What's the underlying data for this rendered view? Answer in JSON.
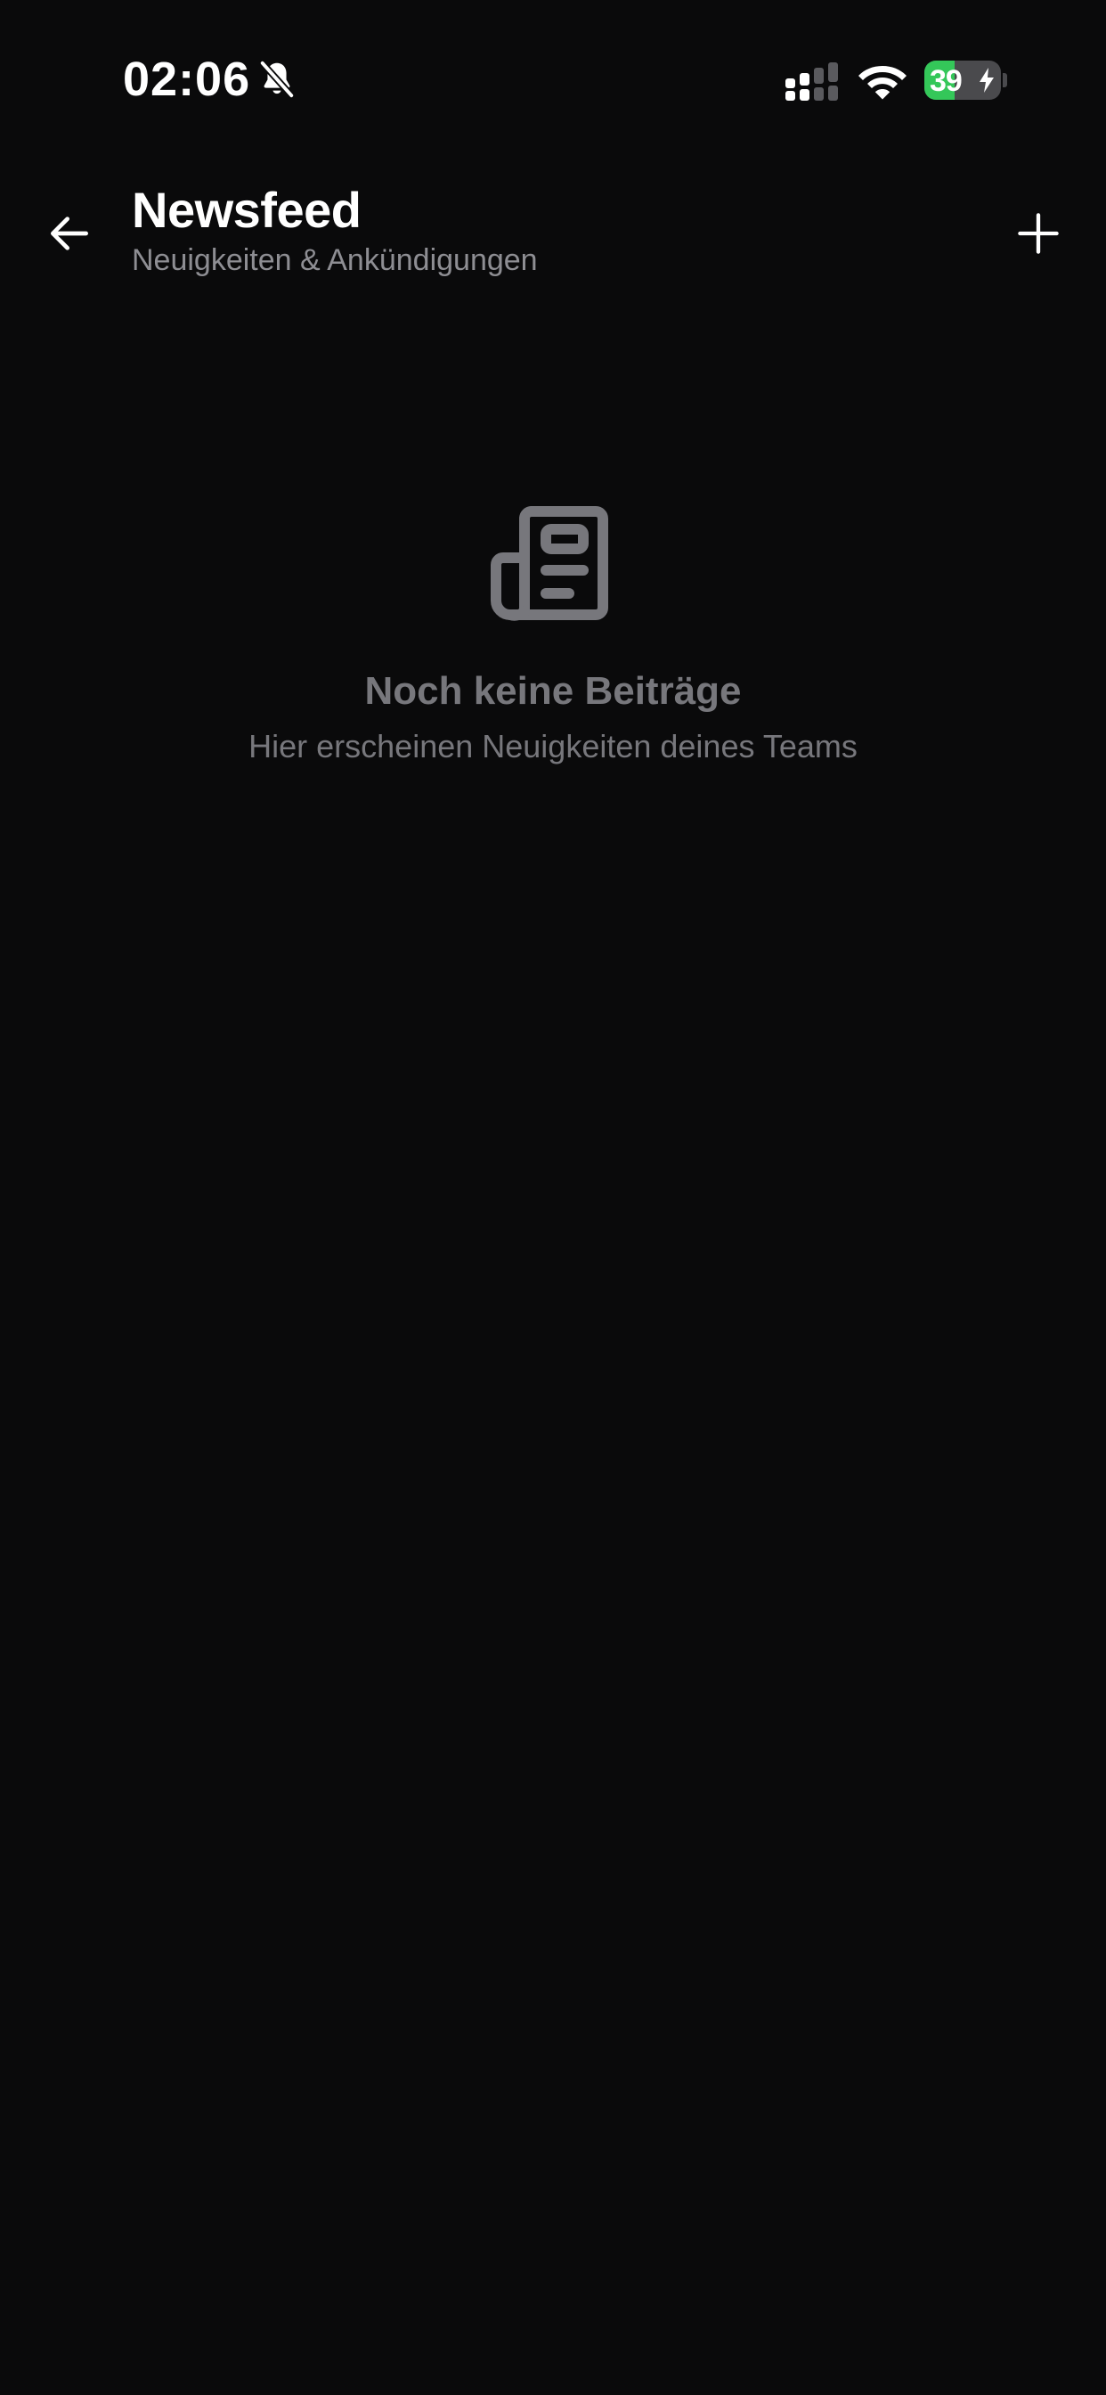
{
  "status_bar": {
    "time": "02:06",
    "battery_percent": "39",
    "battery_level": 0.39,
    "icons": [
      "bell-off-icon",
      "cellular-signal-icon",
      "wifi-icon",
      "battery-charging-icon"
    ],
    "battery_color": "#34c759"
  },
  "header": {
    "title": "Newsfeed",
    "subtitle": "Neuigkeiten & Ankündigungen",
    "back_icon": "arrow-left-icon",
    "add_icon": "plus-icon"
  },
  "empty_state": {
    "icon": "newspaper-icon",
    "title": "Noch keine Beiträge",
    "subtitle": "Hier erscheinen Neuigkeiten deines Teams"
  },
  "colors": {
    "background": "#0a0a0b",
    "text_primary": "#ffffff",
    "text_secondary": "#8e8e93",
    "empty_state": "#77777c"
  }
}
